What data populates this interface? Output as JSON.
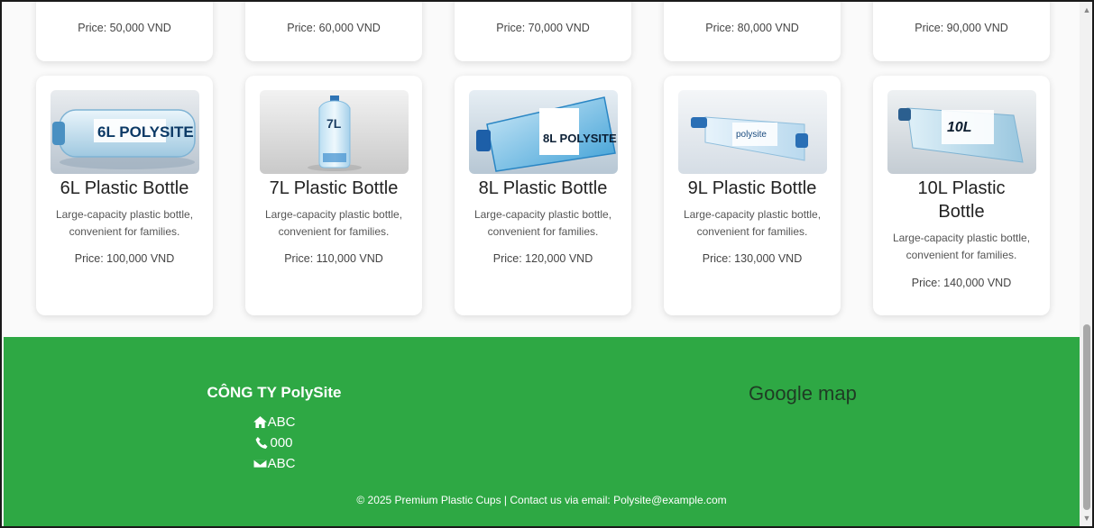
{
  "top_row": [
    {
      "price": "Price: 50,000 VND"
    },
    {
      "price": "Price: 60,000 VND"
    },
    {
      "price": "Price: 70,000 VND"
    },
    {
      "price": "Price: 80,000 VND"
    },
    {
      "price": "Price: 90,000 VND"
    }
  ],
  "products": [
    {
      "image_text": "6L POLYSITE",
      "title": "6L Plastic Bottle",
      "desc_line1": "Large-capacity plastic bottle,",
      "desc_line2": "convenient for families.",
      "price": "Price: 100,000 VND"
    },
    {
      "image_text": "7L",
      "title": "7L Plastic Bottle",
      "desc_line1": "Large-capacity plastic bottle,",
      "desc_line2": "convenient for families.",
      "price": "Price: 110,000 VND"
    },
    {
      "image_text": "8L POLYSITE",
      "title": "8L Plastic Bottle",
      "desc_line1": "Large-capacity plastic bottle,",
      "desc_line2": "convenient for families.",
      "price": "Price: 120,000 VND"
    },
    {
      "image_text": "polysite",
      "title": "9L Plastic Bottle",
      "desc_line1": "Large-capacity plastic bottle,",
      "desc_line2": "convenient for families.",
      "price": "Price: 130,000 VND"
    },
    {
      "image_text": "10L",
      "title_line1": "10L Plastic",
      "title_line2": "Bottle",
      "desc_line1": "Large-capacity plastic bottle,",
      "desc_line2": "convenient for families.",
      "price": "Price: 140,000 VND"
    }
  ],
  "footer": {
    "company": "CÔNG TY PolySite",
    "address": "ABC",
    "phone": "000",
    "email": "ABC",
    "map_label": "Google map",
    "copyright": "© 2025 Premium Plastic Cups | Contact us via email: Polysite@example.com",
    "background_color": "#2ea844"
  },
  "icons": {
    "address": "home-icon",
    "phone": "phone-icon",
    "email": "envelope-icon"
  }
}
